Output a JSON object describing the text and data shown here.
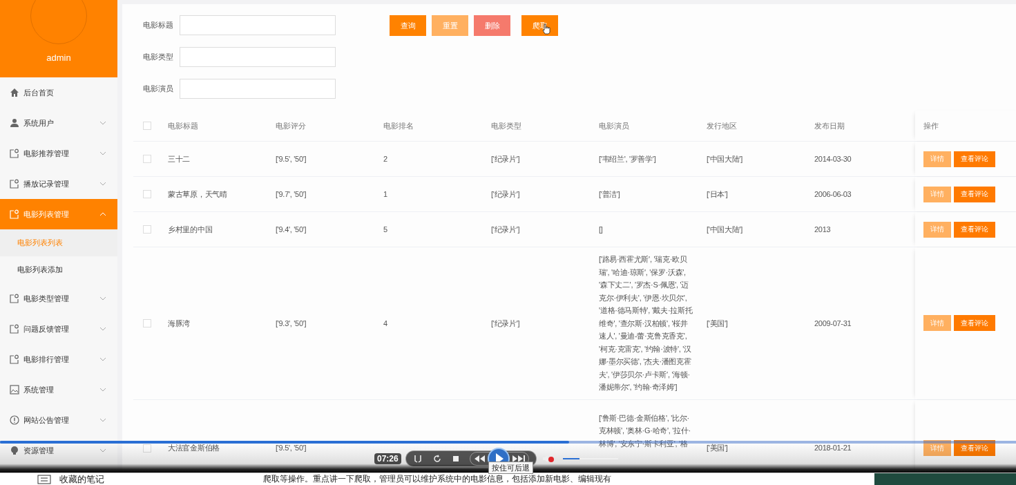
{
  "sidebar": {
    "username": "admin",
    "items": [
      {
        "label": "后台首页",
        "kind": "home",
        "selected": false
      },
      {
        "label": "系统用户",
        "kind": "user",
        "selected": false,
        "expanded": false
      },
      {
        "label": "电影推荐管理",
        "kind": "doc",
        "selected": false,
        "expanded": false
      },
      {
        "label": "播放记录管理",
        "kind": "doc",
        "selected": false,
        "expanded": false
      },
      {
        "label": "电影列表管理",
        "kind": "doc",
        "selected": true,
        "expanded": true,
        "children": [
          {
            "label": "电影列表列表",
            "selected": true
          },
          {
            "label": "电影列表添加",
            "selected": false
          }
        ]
      },
      {
        "label": "电影类型管理",
        "kind": "doc",
        "selected": false,
        "expanded": false
      },
      {
        "label": "问题反馈管理",
        "kind": "doc",
        "selected": false,
        "expanded": false
      },
      {
        "label": "电影排行管理",
        "kind": "doc",
        "selected": false,
        "expanded": false
      },
      {
        "label": "系统管理",
        "kind": "image",
        "selected": false,
        "expanded": false
      },
      {
        "label": "网站公告管理",
        "kind": "info",
        "selected": false,
        "expanded": false
      },
      {
        "label": "资源管理",
        "kind": "bulb",
        "selected": false,
        "expanded": false
      }
    ]
  },
  "search": {
    "fields": [
      {
        "label": "电影标题"
      },
      {
        "label": "电影类型"
      },
      {
        "label": "电影演员"
      }
    ],
    "buttons": [
      {
        "label": "查询",
        "kind": "primary"
      },
      {
        "label": "重置",
        "kind": "light"
      },
      {
        "label": "删除",
        "kind": "danger"
      },
      {
        "label": "爬取",
        "kind": "primary"
      }
    ]
  },
  "table": {
    "select_all_checked": false,
    "columns": [
      "电影标题",
      "电影评分",
      "电影排名",
      "电影类型",
      "电影演员",
      "发行地区",
      "发布日期",
      "操作"
    ],
    "rows": [
      {
        "checked": false,
        "cells": [
          "三十二",
          "['9.5', '50']",
          "2",
          "['纪录片']",
          "['韦绍兰', '罗善学']",
          "['中国大陆']",
          "2014-03-30"
        ],
        "actions": [
          "详情",
          "查看评论"
        ]
      },
      {
        "checked": false,
        "cells": [
          "蒙古草原，天气晴",
          "['9.7', '50']",
          "1",
          "['纪录片']",
          "['普洁']",
          "['日本']",
          "2006-06-03"
        ],
        "actions": [
          "详情",
          "查看评论"
        ]
      },
      {
        "checked": false,
        "cells": [
          "乡村里的中国",
          "['9.4', '50']",
          "5",
          "['纪录片']",
          "[]",
          "['中国大陆']",
          "2013"
        ],
        "actions": [
          "详情",
          "查看评论"
        ]
      },
      {
        "checked": false,
        "cells": [
          "海豚湾",
          "['9.3', '50']",
          "4",
          "['纪录片']",
          "['路易·西霍尤斯', '瑞克·欧贝瑞', '哈迪·琼斯', '保罗·沃森', '森下丈二', '罗杰·S·佩恩', '迈克尔·伊利夫', '伊恩·坎贝尔', '道格·德马斯特', '戴夫·拉斯托维奇', '查尔斯·汉柏顿', '桜井速人', '曼迪-蕾·克鲁克香克', '柯克·克雷克', '约翰·波特', '汉娜·墨尔买德', '杰夫·潘图克霍夫', '伊莎贝尔·卢卡斯', '海顿·潘妮蒂尔', '约翰·奇泽姆']",
          "['美国']",
          "2009-07-31"
        ],
        "actions": [
          "详情",
          "查看评论"
        ]
      },
      {
        "checked": false,
        "cells": [
          "大法官金斯伯格",
          "['9.5', '50']",
          "",
          "",
          "['鲁斯·巴德·金斯伯格', '比尔·克林顿', '奥林·G·哈奇', '拉什·林博', '安东宁·斯卡利亚', '格",
          "['美国']",
          "2018-01-21"
        ],
        "actions": [
          "详情",
          "查看评论"
        ]
      }
    ]
  },
  "player": {
    "time": "07:26",
    "progress": {
      "level": 0.56
    },
    "volume": {
      "level": 0.3,
      "muted": true
    },
    "tooltip": "按住可后退"
  },
  "below": {
    "notes_title": "收藏的笔记",
    "article_text": "爬取等操作。重点讲一下爬取，管理员可以维护系统中的电影信息，包括添加新电影、编辑现有"
  }
}
